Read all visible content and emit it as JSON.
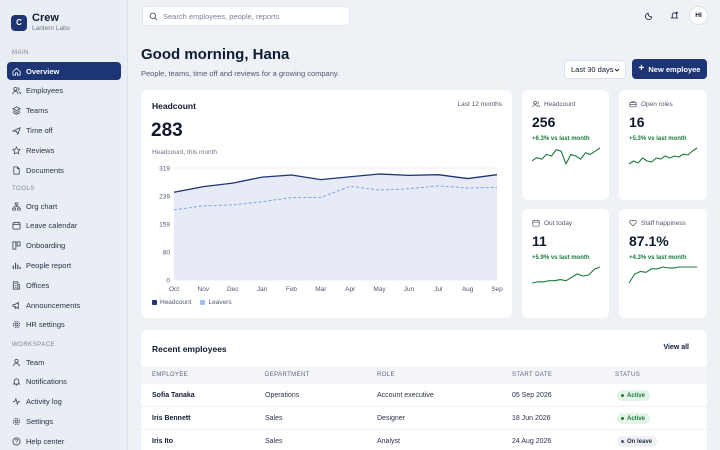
{
  "brand": {
    "name": "Crew",
    "subtitle": "Lantern Labs",
    "logo_letter": "C"
  },
  "sidebar": {
    "sections": [
      {
        "label": "MAIN",
        "items": [
          {
            "label": "Overview",
            "icon": "home-icon",
            "active": true
          },
          {
            "label": "Employees",
            "icon": "users-icon"
          },
          {
            "label": "Teams",
            "icon": "layers-icon"
          },
          {
            "label": "Time off",
            "icon": "plane-icon"
          },
          {
            "label": "Reviews",
            "icon": "star-icon"
          },
          {
            "label": "Documents",
            "icon": "file-icon"
          }
        ]
      },
      {
        "label": "TOOLS",
        "items": [
          {
            "label": "Org chart",
            "icon": "org-icon"
          },
          {
            "label": "Leave calendar",
            "icon": "calendar-icon"
          },
          {
            "label": "Onboarding",
            "icon": "board-icon"
          },
          {
            "label": "People report",
            "icon": "bar-chart-icon"
          },
          {
            "label": "Offices",
            "icon": "building-icon"
          },
          {
            "label": "Announcements",
            "icon": "megaphone-icon"
          },
          {
            "label": "HR settings",
            "icon": "gear-icon"
          }
        ]
      },
      {
        "label": "WORKSPACE",
        "items": [
          {
            "label": "Team",
            "icon": "team-icon"
          },
          {
            "label": "Notifications",
            "icon": "bell-icon"
          },
          {
            "label": "Activity log",
            "icon": "activity-icon"
          },
          {
            "label": "Settings",
            "icon": "gear-icon"
          },
          {
            "label": "Help center",
            "icon": "help-icon"
          }
        ]
      }
    ]
  },
  "topbar": {
    "search_placeholder": "Search employees, people, reports",
    "avatar_initials": "HI"
  },
  "header": {
    "greeting": "Good morning, Hana",
    "subtitle": "People, teams, time off and reviews for a growing company.",
    "range": "Last 30 days",
    "new_button": "New employee"
  },
  "headcount": {
    "title": "Headcount",
    "range": "Last 12 months",
    "value": "283",
    "caption": "Headcount, this month",
    "legend": [
      "Headcount",
      "Leavers"
    ]
  },
  "chart_data": {
    "type": "line",
    "categories": [
      "Oct",
      "Nov",
      "Dec",
      "Jan",
      "Feb",
      "Mar",
      "Apr",
      "May",
      "Jun",
      "Jul",
      "Aug",
      "Sep"
    ],
    "yticks": [
      0,
      80,
      159,
      239,
      319
    ],
    "ylim": [
      0,
      319
    ],
    "series": [
      {
        "name": "Headcount",
        "color": "#1d3575",
        "style": "solid",
        "fill": true,
        "values": [
          250,
          266,
          276,
          293,
          299,
          286,
          294,
          302,
          298,
          300,
          289,
          300
        ]
      },
      {
        "name": "Leavers",
        "color": "#7ea6e0",
        "style": "dashed",
        "fill": false,
        "values": [
          200,
          211,
          214,
          223,
          235,
          235,
          267,
          256,
          260,
          268,
          262,
          264
        ]
      }
    ]
  },
  "kpis": [
    {
      "label": "Headcount",
      "icon": "users-icon",
      "value": "256",
      "delta": "+6.3% vs last month",
      "spark": [
        30,
        32,
        31,
        34,
        33,
        37,
        36,
        28,
        34,
        33,
        31,
        35,
        34,
        36,
        38
      ]
    },
    {
      "label": "Open roles",
      "icon": "briefcase-icon",
      "value": "16",
      "delta": "+5.3% vs last month",
      "spark": [
        24,
        27,
        25,
        30,
        27,
        26,
        30,
        29,
        32,
        30,
        32,
        31,
        34,
        33,
        37,
        40
      ]
    },
    {
      "label": "Out today",
      "icon": "calendar-icon",
      "value": "11",
      "delta": "+5.9% vs last month",
      "spark": [
        22,
        23,
        23,
        24,
        24,
        25,
        24,
        27,
        30,
        28,
        29,
        34,
        36
      ]
    },
    {
      "label": "Staff happiness",
      "icon": "heart-icon",
      "value": "87.1%",
      "delta": "+4.3% vs last month",
      "spark": [
        20,
        30,
        33,
        32,
        36,
        36,
        38,
        37,
        37,
        38,
        38,
        38,
        38
      ]
    }
  ],
  "recent": {
    "title": "Recent employees",
    "view_all": "View all",
    "columns": [
      "EMPLOYEE",
      "DEPARTMENT",
      "ROLE",
      "START DATE",
      "STATUS"
    ],
    "rows": [
      {
        "name": "Sofia Tanaka",
        "department": "Operations",
        "role": "Account executive",
        "start": "05 Sep 2026",
        "status": "Active"
      },
      {
        "name": "Iris Bennett",
        "department": "Sales",
        "role": "Designer",
        "start": "18 Jun 2026",
        "status": "Active"
      },
      {
        "name": "Iris Ito",
        "department": "Sales",
        "role": "Analyst",
        "start": "24 Aug 2026",
        "status": "On leave"
      }
    ]
  },
  "colors": {
    "primary": "#1d3575",
    "success": "#1a7a3a",
    "success_bg": "#e3f3e8",
    "muted_bg": "#eef0f4"
  }
}
